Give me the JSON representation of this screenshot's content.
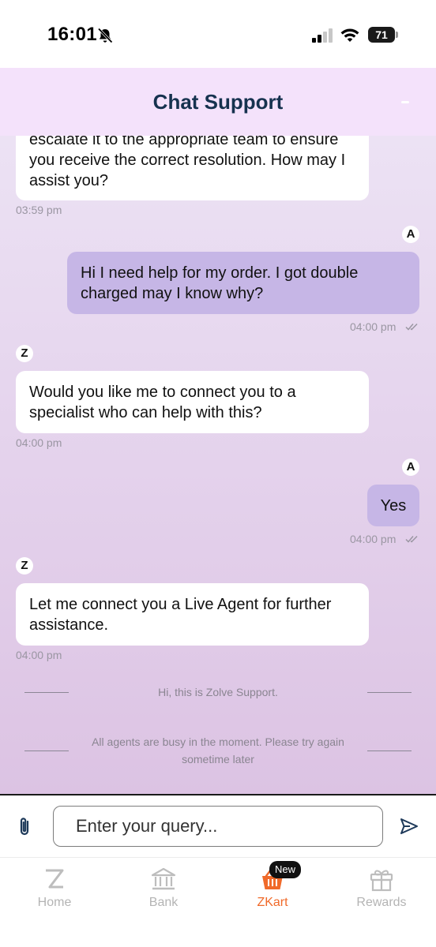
{
  "status_bar": {
    "time": "16:01",
    "battery": "71"
  },
  "header": {
    "title": "Chat Support"
  },
  "messages": {
    "m1": {
      "text": "escalate it to the appropriate team to ensure you receive the correct resolution. How may I assist you?",
      "time": "03:59 pm"
    },
    "m2": {
      "avatar": "A",
      "text": "Hi I need help for my order. I got double charged may I know why?",
      "time": "04:00 pm"
    },
    "m3": {
      "avatar": "Z",
      "text": "Would you like me to connect you to a specialist who can help with this?",
      "time": "04:00 pm"
    },
    "m4": {
      "avatar": "A",
      "text": "Yes",
      "time": "04:00 pm"
    },
    "m5": {
      "avatar": "Z",
      "text": "Let me connect you a Live Agent for further assistance.",
      "time": "04:00 pm"
    }
  },
  "system": {
    "greeting": "Hi, this is Zolve Support.",
    "busy": "All agents are busy in the moment. Please try again sometime later"
  },
  "input": {
    "placeholder": "Enter your query..."
  },
  "tabs": {
    "home": "Home",
    "bank": "Bank",
    "zkart": "ZKart",
    "rewards": "Rewards",
    "badge": "New"
  },
  "colors": {
    "header_bg": "#f4e2fb",
    "title": "#16324f",
    "outgoing_bubble": "#c6b6e6",
    "active_tab": "#f06a2a"
  }
}
